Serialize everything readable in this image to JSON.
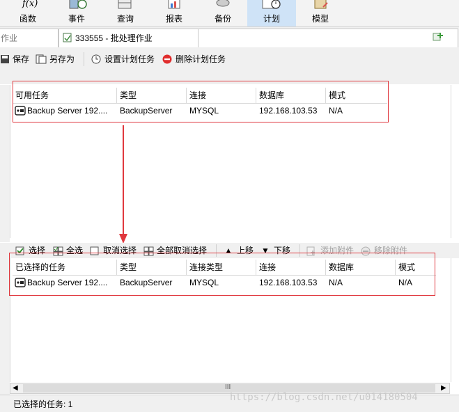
{
  "ribbon": {
    "buttons": [
      {
        "label": "函数",
        "icon": "function-icon"
      },
      {
        "label": "事件",
        "icon": "event-icon"
      },
      {
        "label": "查询",
        "icon": "query-icon"
      },
      {
        "label": "报表",
        "icon": "report-icon"
      },
      {
        "label": "备份",
        "icon": "backup-icon"
      },
      {
        "label": "计划",
        "icon": "schedule-icon",
        "active": true
      },
      {
        "label": "模型",
        "icon": "model-icon"
      }
    ]
  },
  "tabs": {
    "left_tab_text": "作业",
    "active_tab_text": "333555 - 批处理作业"
  },
  "toolbar": {
    "save": "保存",
    "save_as": "另存为",
    "set_schedule": "设置计划任务",
    "delete_schedule": "删除计划任务"
  },
  "available_grid": {
    "columns": [
      "可用任务",
      "类型",
      "连接",
      "数据库",
      "模式"
    ],
    "rows": [
      [
        "Backup Server 192....",
        "BackupServer",
        "MYSQL",
        "192.168.103.53",
        "N/A"
      ]
    ]
  },
  "lower_toolbar": {
    "select": "选择",
    "select_all": "全选",
    "deselect": "取消选择",
    "deselect_all": "全部取消选择",
    "move_up": "上移",
    "move_down": "下移",
    "add_attachment": "添加附件",
    "remove_attachment": "移除附件"
  },
  "selected_grid": {
    "columns": [
      "已选择的任务",
      "类型",
      "连接类型",
      "连接",
      "数据库",
      "模式"
    ],
    "rows": [
      [
        "Backup Server 192....",
        "BackupServer",
        "MYSQL",
        "192.168.103.53",
        "N/A",
        "N/A"
      ]
    ]
  },
  "scrollbar": {
    "grip": "III"
  },
  "status": {
    "text": "已选择的任务: 1"
  },
  "watermark": "https://blog.csdn.net/u014180504",
  "colors": {
    "annotation": "#e0383e",
    "active_tab": "#cfe3f7"
  }
}
